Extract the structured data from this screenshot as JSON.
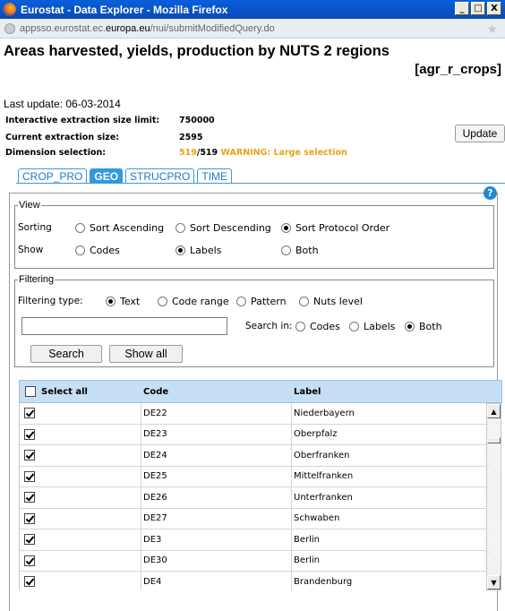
{
  "window": {
    "title": "Eurostat - Data Explorer - Mozilla Firefox",
    "minimize": "_",
    "restore": "□",
    "close": "X"
  },
  "urlbar": {
    "prefix": "appsso.eurostat.ec.",
    "host": "europa.eu",
    "path": "/nui/submitModifiedQuery.do"
  },
  "page": {
    "title": "Areas harvested, yields, production by NUTS 2 regions",
    "dataset_code": "[agr_r_crops]",
    "last_update": "Last update: 06-03-2014",
    "extraction_limit_label": "Interactive extraction size limit:",
    "extraction_limit_value": "750000",
    "current_size_label": "Current extraction size:",
    "current_size_value": "2595",
    "dimension_label": "Dimension selection:",
    "dimension_selected": "519",
    "dimension_total": "/519",
    "warning": "WARNING: Large selection",
    "update_button": "Update"
  },
  "tabs": [
    "CROP_PRO",
    "GEO",
    "STRUCPRO",
    "TIME"
  ],
  "active_tab": "GEO",
  "view": {
    "legend": "View",
    "sorting_label": "Sorting",
    "sort_ascending": "Sort Ascending",
    "sort_descending": "Sort Descending",
    "sort_protocol": "Sort Protocol Order",
    "show_label": "Show",
    "show_codes": "Codes",
    "show_labels": "Labels",
    "show_both": "Both"
  },
  "filtering": {
    "legend": "Filtering",
    "type_label": "Filtering type:",
    "text": "Text",
    "code_range": "Code range",
    "pattern": "Pattern",
    "nuts_level": "Nuts level",
    "search_value": "",
    "search_in_label": "Search in:",
    "in_codes": "Codes",
    "in_labels": "Labels",
    "in_both": "Both",
    "search_button": "Search",
    "show_all_button": "Show all"
  },
  "table": {
    "select_all": "Select all",
    "code_header": "Code",
    "label_header": "Label",
    "rows": [
      {
        "code": "DE22",
        "label": "Niederbayern"
      },
      {
        "code": "DE23",
        "label": "Oberpfalz"
      },
      {
        "code": "DE24",
        "label": "Oberfranken"
      },
      {
        "code": "DE25",
        "label": "Mittelfranken"
      },
      {
        "code": "DE26",
        "label": "Unterfranken"
      },
      {
        "code": "DE27",
        "label": "Schwaben"
      },
      {
        "code": "DE3",
        "label": "Berlin"
      },
      {
        "code": "DE30",
        "label": "Berlin"
      },
      {
        "code": "DE4",
        "label": "Brandenburg"
      }
    ]
  },
  "colors": {
    "titlebar": "#0a5fdc",
    "tab_active": "#3399dd",
    "warning": "#e8a317",
    "table_header": "#c7dff4"
  }
}
